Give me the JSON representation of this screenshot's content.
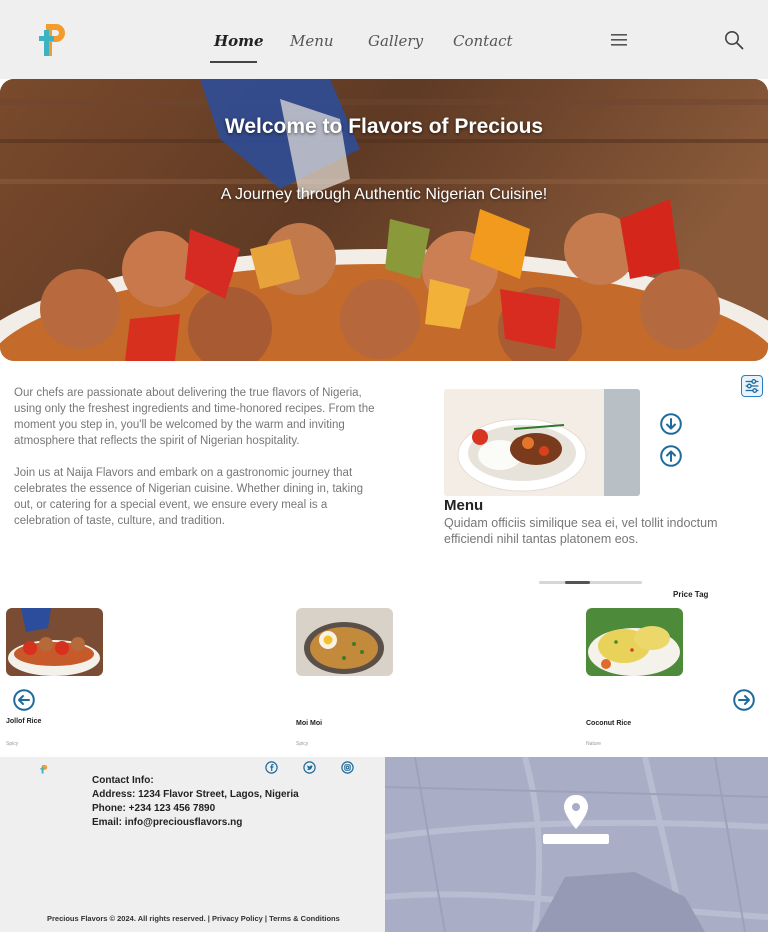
{
  "nav": {
    "items": [
      "Home",
      "Menu",
      "Gallery",
      "Contact"
    ],
    "active_index": 0
  },
  "hero": {
    "title": "Welcome to Flavors of Precious",
    "subtitle": "A Journey through Authentic Nigerian Cuisine!"
  },
  "about": {
    "paragraph1": "Our chefs are passionate about delivering the true flavors of Nigeria, using only the freshest ingredients and time-honored recipes. From the moment you step in, you'll be welcomed by the warm and inviting atmosphere that reflects the spirit of Nigerian hospitality.",
    "paragraph2": "Join us at Naija Flavors and embark on a gastronomic journey that celebrates the essence of Nigerian cuisine. Whether dining in, taking out, or catering for a special event, we ensure every meal is a celebration of taste, culture, and tradition."
  },
  "menu_feature": {
    "title": "Menu",
    "description": "Quidam officiis similique sea ei, vel tollit indoctum efficiendi nihil tantas platonem eos.",
    "carousel_position": 0.25
  },
  "price_tag_label": "Price Tag",
  "dishes": [
    {
      "name": "Jollof Rice",
      "tag": "Spicy"
    },
    {
      "name": "Moi Moi",
      "tag": "Spicy"
    },
    {
      "name": "Coconut Rice",
      "tag": "Nature"
    }
  ],
  "footer": {
    "contact_title": "Contact Info:",
    "address": "Address: 1234 Flavor Street, Lagos, Nigeria",
    "phone": "Phone: +234 123 456 7890",
    "email": "Email: info@preciousflavors.ng",
    "copyright": "Precious Flavors © 2024. All rights reserved. |",
    "privacy": "Privacy Policy",
    "separator": "|",
    "terms": "Terms & Conditions"
  },
  "icons": [
    "logo",
    "hamburger-icon",
    "search-icon",
    "filter-icon",
    "arrow-down-icon",
    "arrow-up-icon",
    "arrow-left-icon",
    "arrow-right-icon",
    "facebook-icon",
    "twitter-icon",
    "instagram-icon",
    "map-pin-icon"
  ],
  "colors": {
    "accent_blue": "#1e6a9c",
    "logo_orange": "#f39c2b",
    "logo_teal": "#3ab3c4",
    "map_bg": "#a9adc6"
  }
}
